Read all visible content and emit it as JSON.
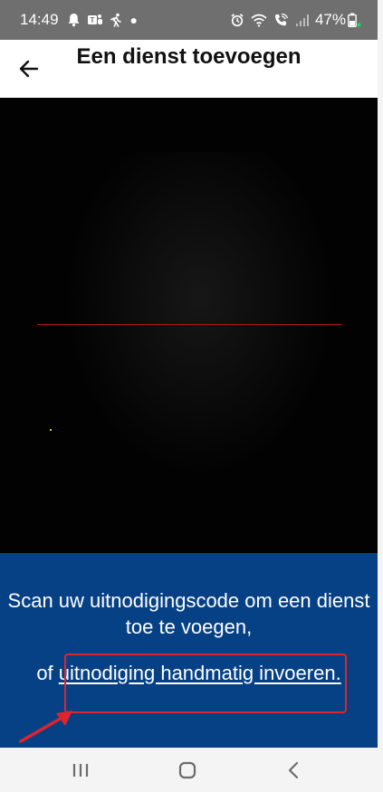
{
  "status_bar": {
    "time": "14:49",
    "battery_percent": "47%",
    "left_icons": [
      "notification-bell-icon",
      "teams-icon",
      "activity-runner-icon"
    ],
    "right_icons": [
      "alarm-icon",
      "wifi-icon",
      "wifi-call-icon",
      "signal-icon",
      "battery-icon"
    ]
  },
  "header": {
    "title": "Een dienst toevoegen",
    "back_icon": "arrow-left-icon"
  },
  "camera": {
    "scan_line_color": "#b01818"
  },
  "instructions": {
    "main_text": "Scan uw uitnodigingscode om een dienst toe te voegen,",
    "manual_prefix": "of",
    "manual_link": "uitnodiging handmatig invoeren."
  },
  "annotation": {
    "highlight_color": "#e0242c"
  },
  "colors": {
    "panel_blue": "#064186",
    "status_gray": "#6f6f6f"
  },
  "nav_bar": {
    "buttons": [
      "recent-apps-icon",
      "home-icon",
      "back-chevron-icon"
    ]
  }
}
